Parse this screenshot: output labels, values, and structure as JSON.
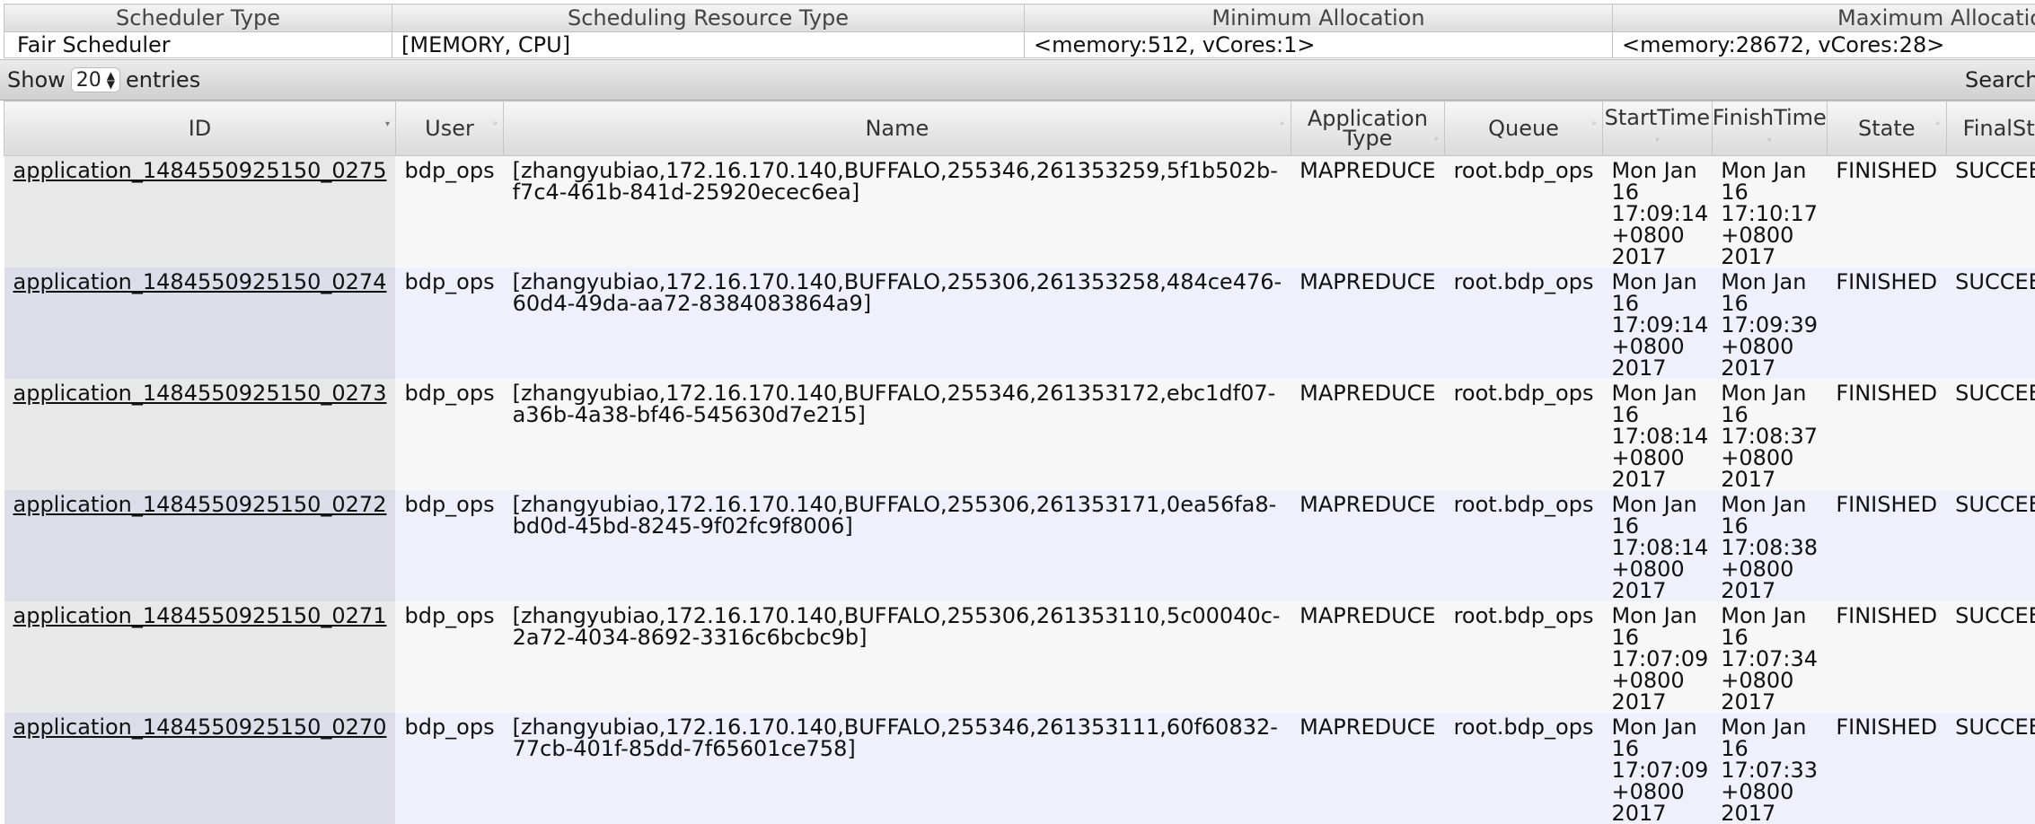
{
  "scheduler": {
    "headers": [
      "Scheduler Type",
      "Scheduling Resource Type",
      "Minimum Allocation",
      "Maximum Allocatio"
    ],
    "row": [
      "Fair Scheduler",
      "[MEMORY, CPU]",
      "<memory:512, vCores:1>",
      "<memory:28672, vCores:28>"
    ]
  },
  "toolbar": {
    "show_label": "Show",
    "show_value": "20",
    "entries_label": "entries",
    "search_label": "Search"
  },
  "columns": [
    "ID",
    "User",
    "Name",
    "Application Type",
    "Queue",
    "StartTime",
    "FinishTime",
    "State",
    "FinalStatus"
  ],
  "apps": [
    {
      "id": "application_1484550925150_0275",
      "user": "bdp_ops",
      "name": "[zhangyubiao,172.16.170.140,BUFFALO,255346,261353259,5f1b502b-f7c4-461b-841d-25920ecec6ea]",
      "type": "MAPREDUCE",
      "queue": "root.bdp_ops",
      "start": [
        "Mon Jan",
        "16",
        "17:09:14",
        "+0800",
        "2017"
      ],
      "finish": [
        "Mon Jan",
        "16",
        "17:10:17",
        "+0800",
        "2017"
      ],
      "state": "FINISHED",
      "final": "SUCCEEDED"
    },
    {
      "id": "application_1484550925150_0274",
      "user": "bdp_ops",
      "name": "[zhangyubiao,172.16.170.140,BUFFALO,255306,261353258,484ce476-60d4-49da-aa72-8384083864a9]",
      "type": "MAPREDUCE",
      "queue": "root.bdp_ops",
      "start": [
        "Mon Jan",
        "16",
        "17:09:14",
        "+0800",
        "2017"
      ],
      "finish": [
        "Mon Jan",
        "16",
        "17:09:39",
        "+0800",
        "2017"
      ],
      "state": "FINISHED",
      "final": "SUCCEEDED"
    },
    {
      "id": "application_1484550925150_0273",
      "user": "bdp_ops",
      "name": "[zhangyubiao,172.16.170.140,BUFFALO,255346,261353172,ebc1df07-a36b-4a38-bf46-545630d7e215]",
      "type": "MAPREDUCE",
      "queue": "root.bdp_ops",
      "start": [
        "Mon Jan",
        "16",
        "17:08:14",
        "+0800",
        "2017"
      ],
      "finish": [
        "Mon Jan",
        "16",
        "17:08:37",
        "+0800",
        "2017"
      ],
      "state": "FINISHED",
      "final": "SUCCEEDED"
    },
    {
      "id": "application_1484550925150_0272",
      "user": "bdp_ops",
      "name": "[zhangyubiao,172.16.170.140,BUFFALO,255306,261353171,0ea56fa8-bd0d-45bd-8245-9f02fc9f8006]",
      "type": "MAPREDUCE",
      "queue": "root.bdp_ops",
      "start": [
        "Mon Jan",
        "16",
        "17:08:14",
        "+0800",
        "2017"
      ],
      "finish": [
        "Mon Jan",
        "16",
        "17:08:38",
        "+0800",
        "2017"
      ],
      "state": "FINISHED",
      "final": "SUCCEEDED"
    },
    {
      "id": "application_1484550925150_0271",
      "user": "bdp_ops",
      "name": "[zhangyubiao,172.16.170.140,BUFFALO,255306,261353110,5c00040c-2a72-4034-8692-3316c6bcbc9b]",
      "type": "MAPREDUCE",
      "queue": "root.bdp_ops",
      "start": [
        "Mon Jan",
        "16",
        "17:07:09",
        "+0800",
        "2017"
      ],
      "finish": [
        "Mon Jan",
        "16",
        "17:07:34",
        "+0800",
        "2017"
      ],
      "state": "FINISHED",
      "final": "SUCCEEDED"
    },
    {
      "id": "application_1484550925150_0270",
      "user": "bdp_ops",
      "name": "[zhangyubiao,172.16.170.140,BUFFALO,255346,261353111,60f60832-77cb-401f-85dd-7f65601ce758]",
      "type": "MAPREDUCE",
      "queue": "root.bdp_ops",
      "start": [
        "Mon Jan",
        "16",
        "17:07:09",
        "+0800",
        "2017"
      ],
      "finish": [
        "Mon Jan",
        "16",
        "17:07:33",
        "+0800",
        "2017"
      ],
      "state": "FINISHED",
      "final": "SUCCEEDED"
    }
  ]
}
